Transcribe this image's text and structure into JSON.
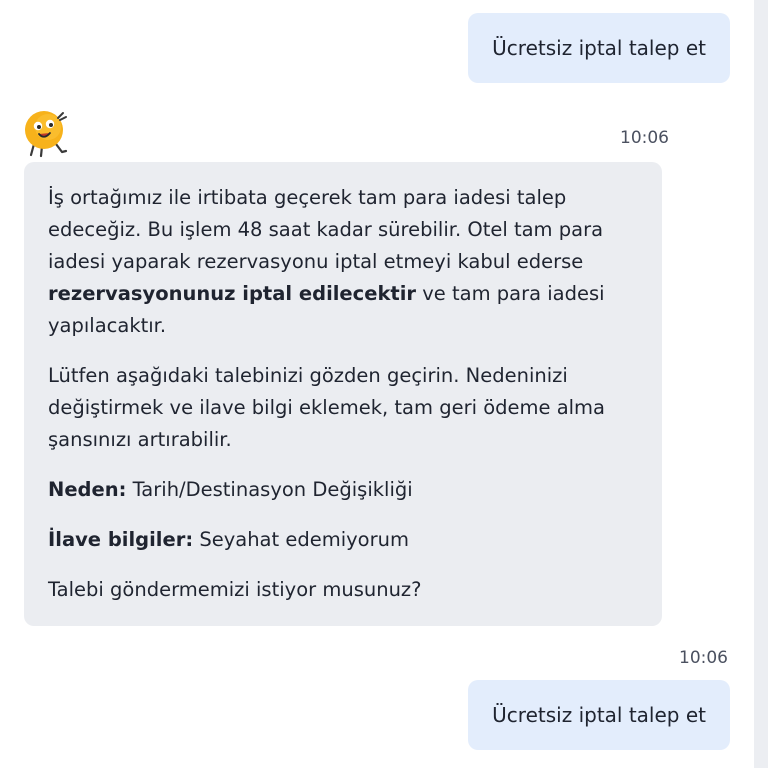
{
  "messages": {
    "user_top": "Ücretsiz iptal talep et",
    "user_bottom": "Ücretsiz iptal talep et",
    "bot_time": "10:06",
    "user_time": "10:06",
    "bot": {
      "p1_a": "İş ortağımız ile irtibata geçerek tam para iadesi talep edeceğiz. Bu işlem 48 saat kadar sürebilir. Otel tam para iadesi yaparak rezervasyonu iptal etmeyi kabul ederse ",
      "p1_bold": "rezervasyonunuz iptal edilecektir",
      "p1_b": " ve tam para iadesi yapılacaktır.",
      "p2": "Lütfen aşağıdaki talebinizi gözden geçirin. Nedeninizi değiştirmek ve ilave bilgi eklemek, tam geri ödeme alma şansınızı artırabilir.",
      "reason_label": "Neden:",
      "reason_value": " Tarih/Destinasyon Değişikliği",
      "info_label": "İlave bilgiler:",
      "info_value": " Seyahat edemiyorum",
      "question": "Talebi göndermemizi istiyor musunuz?"
    }
  },
  "colors": {
    "user_bubble": "#e3edfc",
    "bot_bubble": "#ebedf1",
    "avatar_fill": "#f7b21b"
  },
  "icons": {
    "avatar": "mascot-avatar-icon"
  }
}
